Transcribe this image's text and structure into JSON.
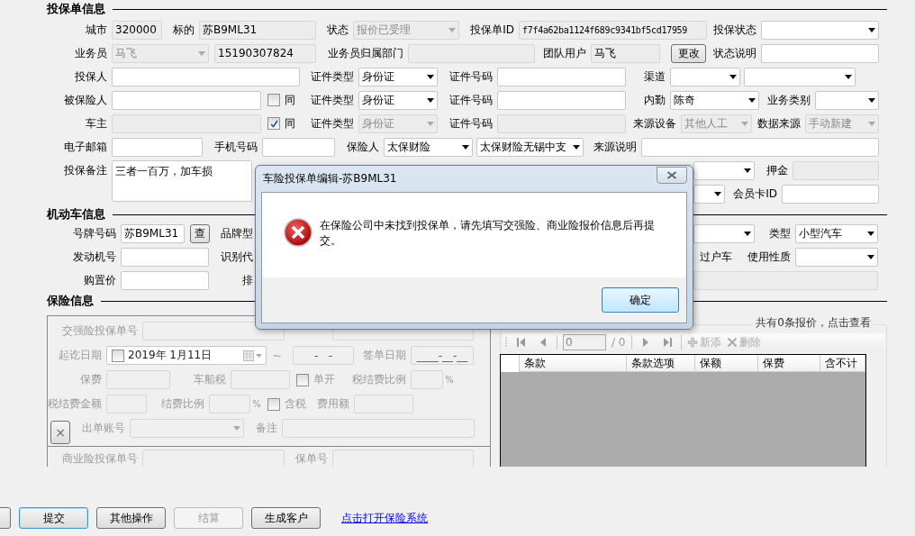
{
  "policy_info": {
    "title": "投保单信息",
    "rows": [
      {
        "fields": [
          {
            "label": "城市",
            "kind": "text",
            "value": "320000",
            "disabled": true
          },
          {
            "label": "标的",
            "kind": "text",
            "value": "苏B9ML31",
            "disabled": true
          },
          {
            "label": "状态",
            "kind": "select",
            "value": "报价已受理",
            "disabled": true
          },
          {
            "label": "投保单ID",
            "kind": "text",
            "value": "f7f4a62ba1124f689c9341bf5cd17959",
            "disabled": true
          },
          {
            "label": "投保状态",
            "kind": "select",
            "disabled": false
          }
        ]
      },
      {
        "fields": [
          {
            "label": "业务员",
            "kind": "select",
            "value": "马飞",
            "disabled": true
          },
          {
            "kind": "text",
            "value": "15190307824",
            "disabled": true
          },
          {
            "label": "业务员归属部门",
            "kind": "text",
            "disabled": true
          },
          {
            "label": "团队用户",
            "kind": "text",
            "value": "马飞",
            "disabled": true
          },
          {
            "kind": "button",
            "label": "更改",
            "disabled": false
          },
          {
            "label": "状态说明",
            "kind": "text",
            "disabled": false
          }
        ]
      },
      {
        "fields": [
          {
            "label": "投保人",
            "kind": "text",
            "disabled": false
          },
          {
            "label": "证件类型",
            "kind": "select",
            "value": "身份证",
            "disabled": false
          },
          {
            "label": "证件号码",
            "kind": "text",
            "disabled": false
          },
          {
            "label": "渠道",
            "kind": "select",
            "disabled": false
          },
          {
            "kind": "select",
            "disabled": false
          }
        ]
      },
      {
        "fields": [
          {
            "label": "被保险人",
            "kind": "text",
            "disabled": false
          },
          {
            "kind": "check",
            "label": "同",
            "checked": false
          },
          {
            "label": "证件类型",
            "kind": "select",
            "value": "身份证",
            "disabled": false
          },
          {
            "label": "证件号码",
            "kind": "text",
            "disabled": false
          },
          {
            "label": "内勤",
            "kind": "select",
            "value": "陈奇",
            "disabled": false
          },
          {
            "label": "业务类别",
            "kind": "select",
            "disabled": false
          }
        ]
      },
      {
        "fields": [
          {
            "label": "车主",
            "kind": "text",
            "disabled": true
          },
          {
            "kind": "check",
            "label": "同",
            "checked": true
          },
          {
            "label": "证件类型",
            "kind": "select",
            "value": "身份证",
            "disabled": true
          },
          {
            "label": "证件号码",
            "kind": "text",
            "disabled": true
          },
          {
            "label": "来源设备",
            "kind": "select",
            "value": "其他人工",
            "disabled": true
          },
          {
            "label": "数据来源",
            "kind": "select",
            "value": "手动新建",
            "disabled": true
          }
        ]
      },
      {
        "fields": [
          {
            "label": "电子邮箱",
            "kind": "text",
            "disabled": false
          },
          {
            "label": "手机号码",
            "kind": "text",
            "disabled": false
          },
          {
            "label": "保险人",
            "kind": "select",
            "value": "太保财险",
            "disabled": false
          },
          {
            "kind": "select",
            "value": "太保财险无锡中支",
            "disabled": false
          },
          {
            "label": "来源说明",
            "kind": "text",
            "disabled": false
          }
        ]
      }
    ],
    "notes": {
      "label": "投保备注",
      "value": "三者一百万，加车损",
      "disabled": false
    },
    "side_rows": [
      {
        "fields": [
          {
            "kind": "select",
            "disabled": false
          },
          {
            "label": "押金",
            "kind": "text",
            "disabled": true
          }
        ]
      },
      {
        "fields": [
          {
            "kind": "select",
            "disabled": false
          },
          {
            "label": "会员卡ID",
            "kind": "text",
            "disabled": false
          }
        ]
      }
    ]
  },
  "vehicle_info": {
    "title": "机动车信息",
    "rows": [
      {
        "fields": [
          {
            "label": "号牌号码",
            "kind": "text",
            "value": "苏B9ML31",
            "disabled": false
          },
          {
            "kind": "button",
            "label": "查",
            "disabled": false
          },
          {
            "kind": "label",
            "label": "品牌型"
          },
          {
            "kind": "select",
            "disabled": false
          },
          {
            "label": "类型",
            "kind": "select",
            "value": "小型汽车",
            "disabled": false
          }
        ]
      },
      {
        "fields": [
          {
            "label": "发动机号",
            "kind": "text",
            "disabled": false
          },
          {
            "kind": "label",
            "label": "识别代"
          },
          {
            "kind": "label",
            "label": "过户车"
          },
          {
            "label": "使用性质",
            "kind": "select",
            "disabled": false
          }
        ]
      },
      {
        "fields": [
          {
            "label": "购置价",
            "kind": "text",
            "disabled": false
          },
          {
            "kind": "label",
            "label": "排"
          },
          {
            "kind": "text",
            "disabled": true
          }
        ]
      }
    ]
  },
  "insurance_info": {
    "title": "保险信息",
    "disabled": true,
    "compulsory_rows": [
      {
        "fields": [
          {
            "label": "交强险投保单号",
            "kind": "text",
            "disabled": true
          },
          {
            "kind": "text",
            "disabled": true
          }
        ]
      },
      {
        "fields": [
          {
            "label": "起讫日期",
            "kind": "date",
            "value": "2019年 1月11日",
            "checked": false,
            "disabled": false
          },
          {
            "kind": "label",
            "label": "~"
          },
          {
            "kind": "text",
            "value": "-   -",
            "disabled": true
          },
          {
            "label": "签单日期",
            "kind": "text",
            "value": "____-__-__",
            "disabled": true
          }
        ]
      },
      {
        "fields": [
          {
            "label": "保费",
            "kind": "text",
            "disabled": true
          },
          {
            "label": "车船税",
            "kind": "text",
            "disabled": true
          },
          {
            "kind": "check",
            "label": "单开",
            "checked": false
          },
          {
            "label": "税结费比例",
            "kind": "text",
            "suffix": "%",
            "disabled": true
          }
        ]
      },
      {
        "fields": [
          {
            "label": "税结费金额",
            "kind": "text",
            "disabled": true
          },
          {
            "label": "结费比例",
            "kind": "text",
            "suffix": "%",
            "disabled": true
          },
          {
            "kind": "check",
            "label": "含税",
            "checked": false
          },
          {
            "label": "费用额",
            "kind": "text",
            "disabled": true
          }
        ]
      },
      {
        "fields": [
          {
            "kind": "button",
            "label": "×",
            "disabled": false
          },
          {
            "label": "出单账号",
            "kind": "select",
            "disabled": true
          },
          {
            "label": "备注",
            "kind": "text",
            "disabled": true
          }
        ]
      }
    ],
    "commercial_rows": [
      {
        "fields": [
          {
            "label": "商业险投保单号",
            "kind": "text",
            "disabled": true
          },
          {
            "label": "保单号",
            "kind": "text",
            "disabled": true
          }
        ]
      }
    ]
  },
  "quotes": {
    "title": "共有0条报价，点击查看",
    "page": "0",
    "page_total": "/ 0",
    "add_label": "新添",
    "delete_label": "删除",
    "columns": [
      "条款",
      "条款选项",
      "保额",
      "保费",
      "含不计"
    ]
  },
  "buttons": [
    {
      "label": "提交",
      "focused": true,
      "disabled": false
    },
    {
      "label": "其他操作",
      "focused": false,
      "disabled": false
    },
    {
      "label": "结算",
      "focused": false,
      "disabled": true
    },
    {
      "label": "生成客户",
      "focused": false,
      "disabled": false
    }
  ],
  "link": "点击打开保险系统",
  "dialog": {
    "title": "车险投保单编辑-苏B9ML31",
    "message": "在保险公司中未找到投保单，请先填写交强险、商业险报价信息后再提交。",
    "ok": "确定"
  }
}
